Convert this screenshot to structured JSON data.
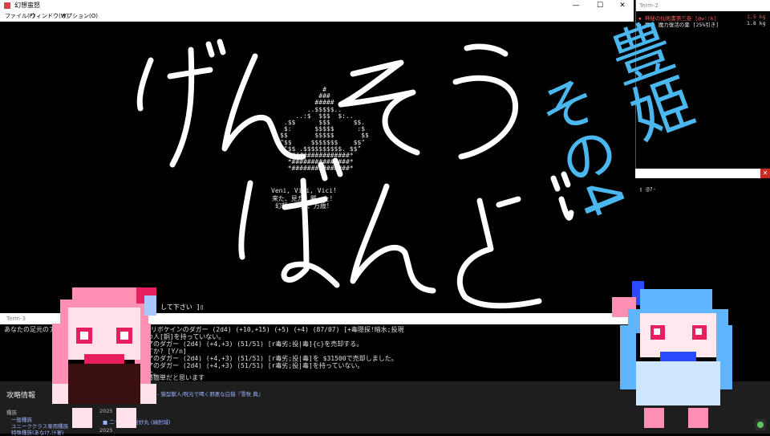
{
  "main": {
    "title": "幻想蛮怒",
    "menu": [
      "ファイル(F)",
      "ウィンドウ(W)",
      "オプション(O)"
    ],
    "ascii_art": "                #\n               ###\n              #####\n            ..$$$$$..\n         ..:$  $$$  $:..\n      .$$      $$$      $$.\n      $:      $$$$$      :$\n     $$       $$$$$       $$\n     \"$$     $$$$$$$    $$\"\n      \"$$ .$$$$$$$$$$. $$\"\n       *###############*\n       *###############*\n       *###############*",
    "victory_lines": [
      "Veni, Vidi, Vici!",
      "来た、見た、勝った！",
      "幻想の少女、万歳！"
    ],
    "prompt": "して下さい ]▯",
    "handwriting_big": "げんそう",
    "handwriting_big2": "ばんど"
  },
  "term2": {
    "title": "Term-2",
    "rows": [
      {
        "text": "▪ 神秘の仙術書第三巻 [@w!!k]",
        "weight": "1.5 kg",
        "color": "#ff5a5a"
      },
      {
        "text": "▪ 魔の 魔力復活の薬 [25%引き]",
        "weight": "1.8 kg",
        "color": "#e0e0e0"
      }
    ],
    "prompt_line": "▯ @?-"
  },
  "term3": {
    "title": "Term-3",
    "lines": [
      "あなたの足元のアイ",
      "★トリボケインのダガー (2d4) (+10,+15) (+5) (+4) (87/07) [+毒隠探!暗水;投現",
      "いつ人[銅]を持っていない。",
      "リアのダガー (2d4) (+4,+3) (51/51) [r毒劣;投|毒]{c}を売却する。",
      "ますか? [Y/n]",
      "リアのダガー (2d4) (+4,+3) (51/51) [r毒劣;投|毒]を $31500で売却しました。",
      "リアのダガー (2d4) (+4,+3) (51/51) [r毒劣;投|毒]を持っていない。",
      "れた。",
      "ー番簡単だと思います"
    ]
  },
  "web": {
    "heading": "攻略情報",
    "breadcrumb": "- 猫型獣人/呪元で喝く邪悪な白猫『雪牧 典』",
    "side_items": [
      "種族",
      "一般種族",
      "ユニーククラス専用種族",
      "特殊種族(あなけ,汁宴)"
    ],
    "year1": "2025",
    "entry": "■ 二つ名  名  封妙丸 (緑肘城)",
    "year2": "2025"
  },
  "overlay": {
    "vertical1": "豊姫",
    "vertical2": "その4"
  },
  "colors": {
    "accent_blue": "#4ab7ee",
    "handwriting": "#ffffff"
  }
}
